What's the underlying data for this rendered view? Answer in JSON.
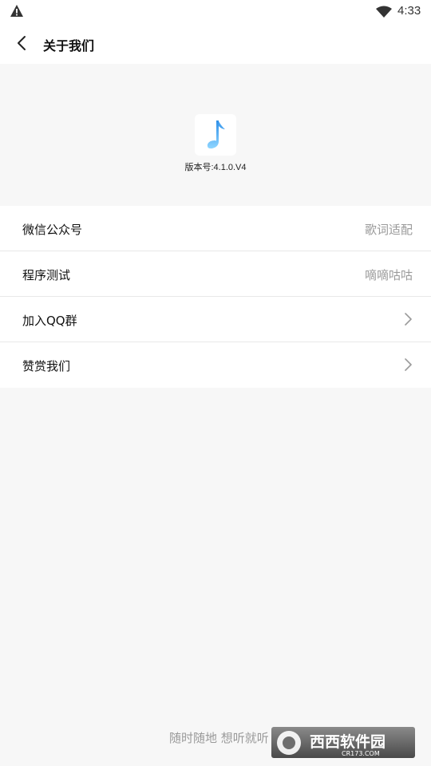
{
  "status_bar": {
    "time": "4:33",
    "icons": [
      "warning-icon",
      "wifi-icon"
    ]
  },
  "app_bar": {
    "title": "关于我们",
    "back_icon": "back-arrow-icon"
  },
  "about": {
    "app_icon": "music-note-icon",
    "version": "版本号:4.1.0.V4"
  },
  "list": {
    "items": [
      {
        "label": "微信公众号",
        "value": "歌词适配"
      },
      {
        "label": "程序测试",
        "value": "嘀嘀咕咕"
      },
      {
        "label": "加入QQ群"
      },
      {
        "label": "赞赏我们"
      }
    ]
  },
  "footer": {
    "slogan": "随时随地 想听就听",
    "watermark": {
      "title": "西西软件园",
      "subtitle": "CR173.COM"
    }
  },
  "colors": {
    "background": "#f7f7f7",
    "card": "#ffffff",
    "text": "#111111",
    "secondary_text": "#9a9a9a",
    "icon_blue": "#57b3f5"
  }
}
